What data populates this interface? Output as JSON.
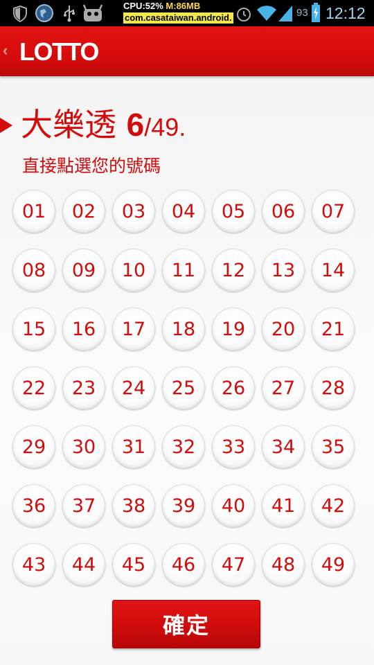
{
  "status_bar": {
    "cpu": "CPU:52%",
    "mem": "M:86MB",
    "package": "com.casataiwan.android.",
    "battery": "93",
    "time": "12:12",
    "icons": [
      "shield-icon",
      "browser-globe-icon",
      "usb-icon",
      "android-icon",
      "alarm-icon",
      "wifi-icon",
      "signal-icon",
      "battery-icon"
    ]
  },
  "header": {
    "back_glyph": "‹",
    "title": "LOTTO"
  },
  "game": {
    "name": "大樂透",
    "format_pick": "6",
    "format_rest": "/49.",
    "instruction": "直接點選您的號碼"
  },
  "numbers": [
    "01",
    "02",
    "03",
    "04",
    "05",
    "06",
    "07",
    "08",
    "09",
    "10",
    "11",
    "12",
    "13",
    "14",
    "15",
    "16",
    "17",
    "18",
    "19",
    "20",
    "21",
    "22",
    "23",
    "24",
    "25",
    "26",
    "27",
    "28",
    "29",
    "30",
    "31",
    "32",
    "33",
    "34",
    "35",
    "36",
    "37",
    "38",
    "39",
    "40",
    "41",
    "42",
    "43",
    "44",
    "45",
    "46",
    "47",
    "48",
    "49"
  ],
  "confirm_label": "確定",
  "colors": {
    "accent": "#d40b0b",
    "status_time": "#9fd3ee"
  }
}
